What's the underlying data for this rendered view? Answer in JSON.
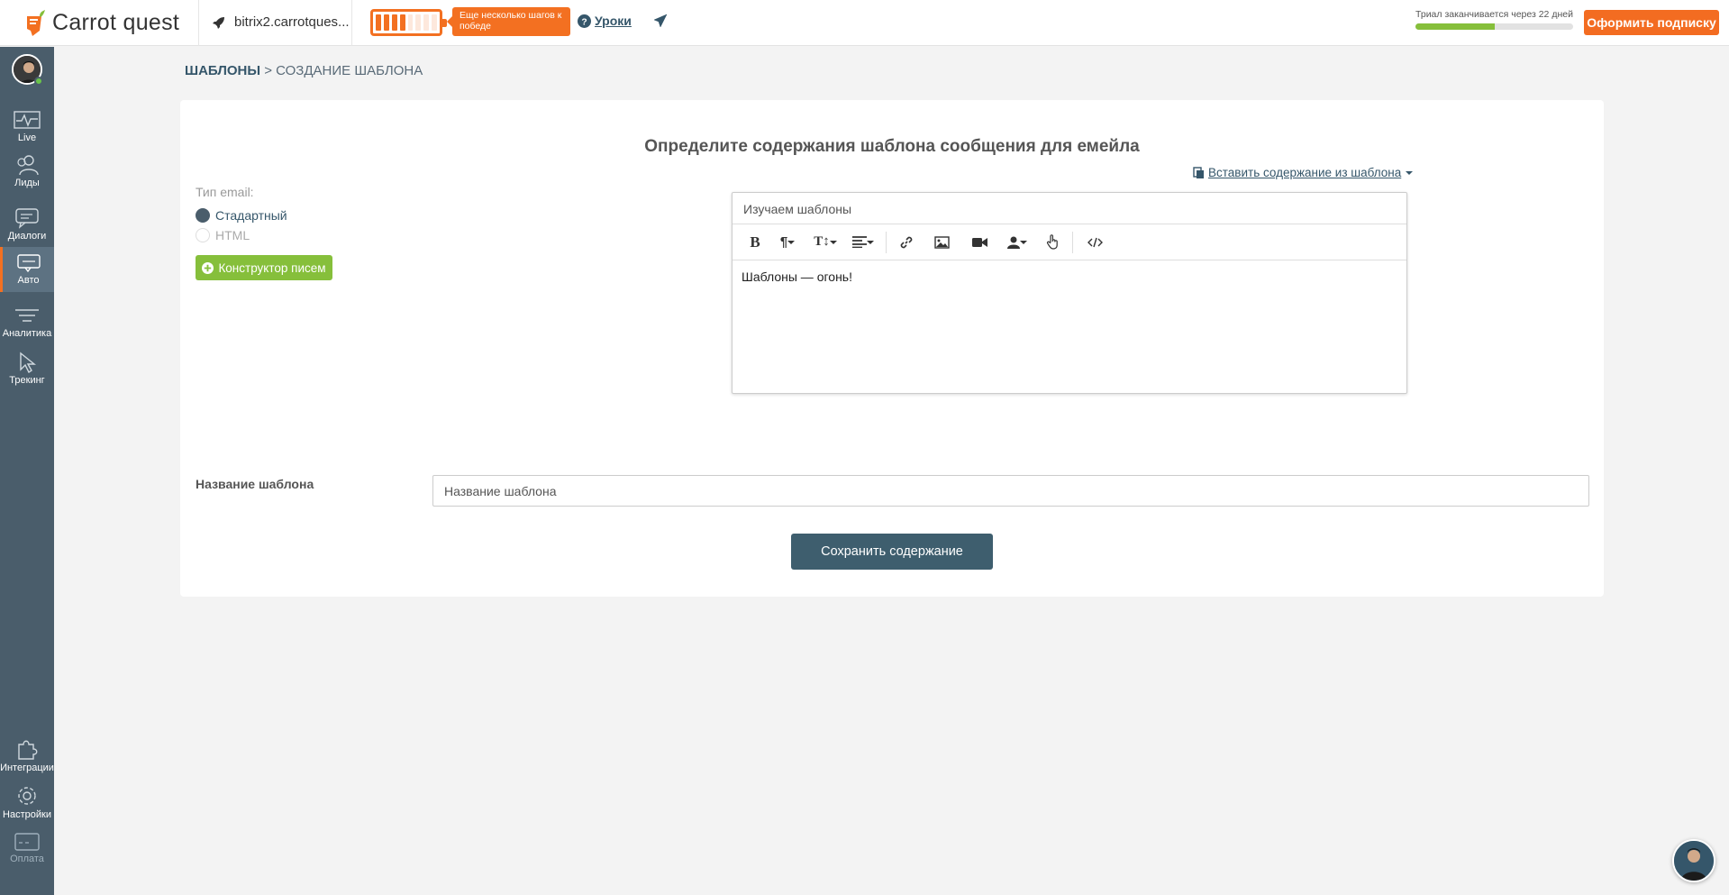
{
  "app": {
    "title": "Carrot quest"
  },
  "header": {
    "project_name": "bitrix2.carrotques...",
    "onboarding_tip": "Еще несколько шагов к победе",
    "lessons_label": "Уроки",
    "trial_text": "Триал заканчивается через 22 дней",
    "trial_progress": 0.5,
    "battery_level": 4,
    "subscribe_label": "Оформить подписку"
  },
  "sidebar": {
    "items": [
      {
        "label": "Live"
      },
      {
        "label": "Лиды"
      },
      {
        "label": "Диалоги"
      },
      {
        "label": "Авто"
      },
      {
        "label": "Аналитика"
      },
      {
        "label": "Трекинг"
      },
      {
        "label": "Интеграции"
      },
      {
        "label": "Настройки"
      },
      {
        "label": "Оплата"
      }
    ],
    "active": "Авто"
  },
  "breadcrumb": {
    "root": "ШАБЛОНЫ",
    "separator": ">",
    "current": "СОЗДАНИЕ ШАБЛОНА"
  },
  "form": {
    "heading": "Определите содержания шаблона сообщения для емейла",
    "insert_template_label": "Вставить содержание из шаблона",
    "email_type_label": "Тип email:",
    "email_types": [
      "Стадартный",
      "HTML"
    ],
    "email_type_selected": "Стадартный",
    "constructor_label": "Конструктор писем",
    "subject_value": "Изучаем шаблоны",
    "body_text": "Шаблоны — огонь!",
    "template_name_label": "Название шаблона",
    "template_name_value": "Название шаблона",
    "save_label": "Сохранить содержание"
  },
  "toolbar": {
    "icons": [
      "bold-icon",
      "paragraph-icon",
      "font-size-icon",
      "align-icon",
      "link-icon",
      "image-icon",
      "video-icon",
      "user-variable-icon",
      "pointer-icon",
      "code-icon"
    ],
    "bold_label": "B",
    "paragraph_label": "¶",
    "fontsize_label": "T↕"
  },
  "colors": {
    "accent": "#f37021",
    "sidebar": "#4a5d6b",
    "primary": "#3e5e6e",
    "green": "#86bf3b",
    "link": "#35566a"
  }
}
